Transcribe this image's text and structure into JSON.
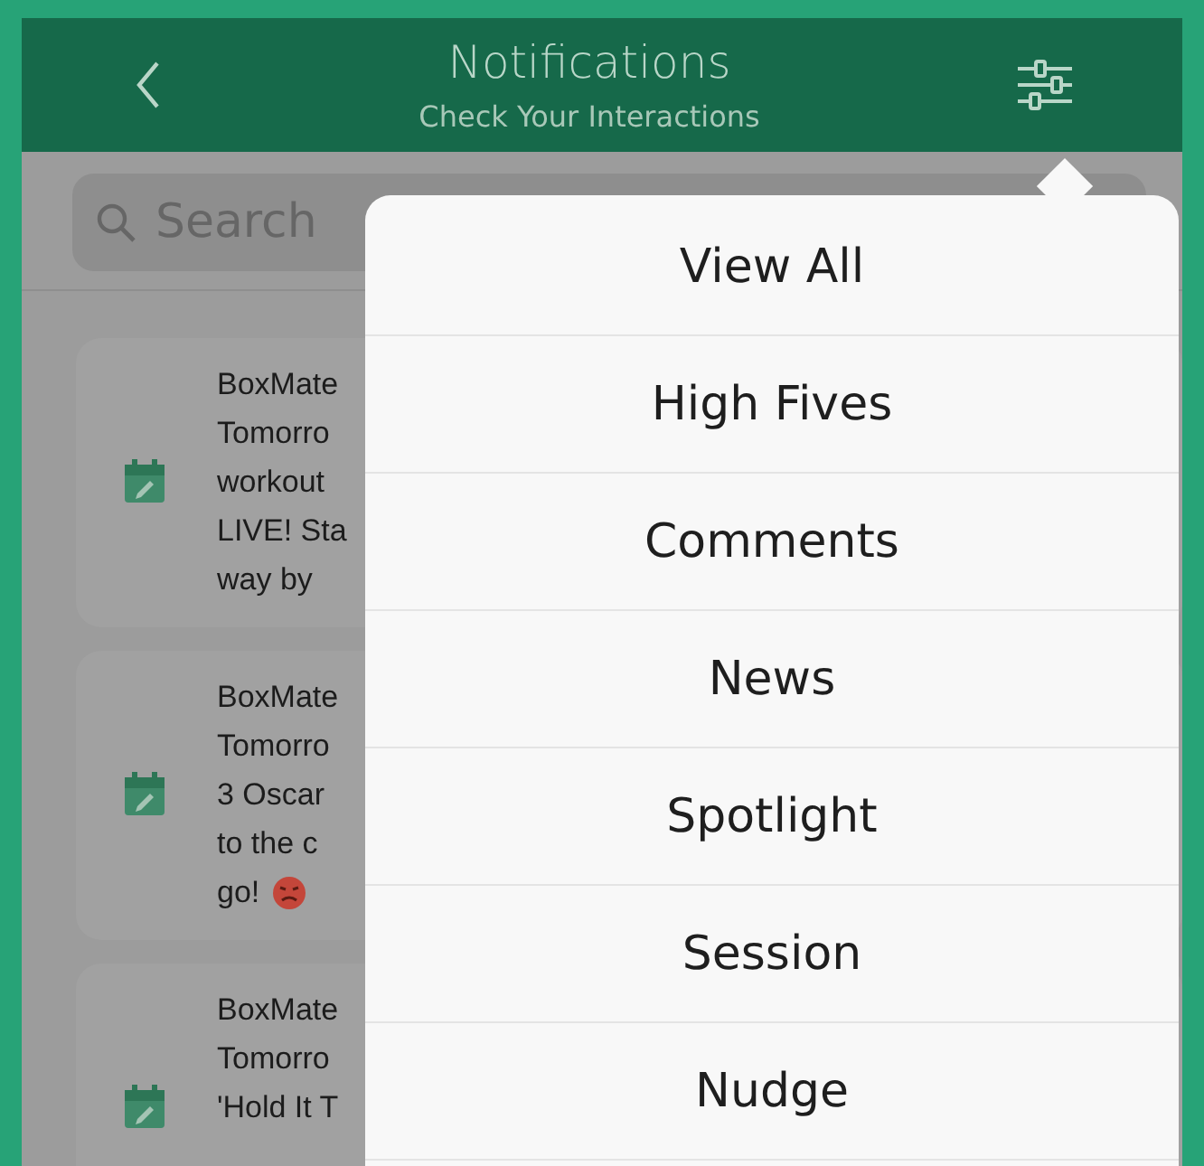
{
  "header": {
    "title": "Notifications",
    "subtitle": "Check Your Interactions"
  },
  "search": {
    "placeholder": "Search"
  },
  "notifications": [
    {
      "lines": [
        "BoxMate",
        "Tomorro",
        "workout",
        "LIVE! Sta",
        "way by"
      ],
      "emoji": false
    },
    {
      "lines": [
        "BoxMate",
        "Tomorro",
        "3 Oscar",
        "to the c",
        "go!"
      ],
      "emoji": true
    },
    {
      "lines": [
        "BoxMate",
        "Tomorro",
        "'Hold It T"
      ],
      "emoji": false
    }
  ],
  "filter_menu": {
    "items": [
      "View All",
      "High Fives",
      "Comments",
      "News",
      "Spotlight",
      "Session",
      "Nudge"
    ]
  }
}
